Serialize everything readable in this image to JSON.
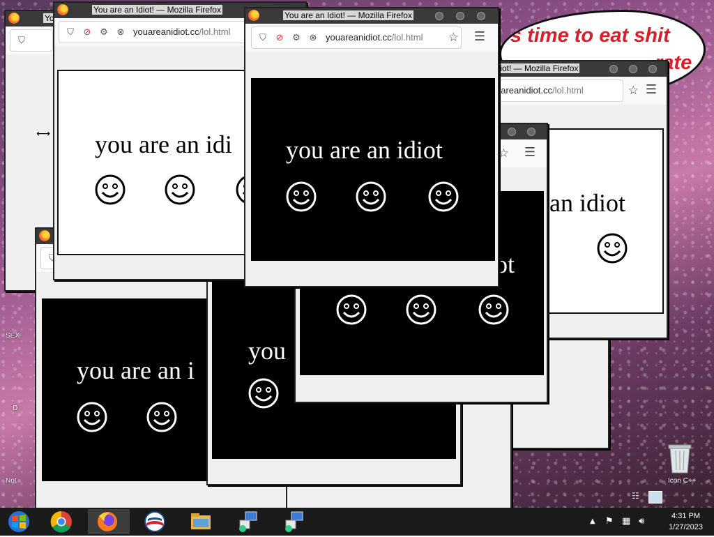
{
  "browser": {
    "title": "You are an Idiot! — Mozilla Firefox",
    "title_short": "Yo",
    "title_partial": "idiot! — Mozilla Firefox",
    "url_host": "youareanidiot.cc",
    "url_path": "/lol.html",
    "url_host_partial": "uareanidiot.cc"
  },
  "page": {
    "text": "you are an idiot",
    "text_cut1": "you are an idi",
    "text_cut2": "you are an i",
    "text_cut3": "you",
    "text_cut4": "an idiot",
    "text_cut5": "ot"
  },
  "desktop": {
    "speech_line1": "'s time to eat shit",
    "speech_line2": "rate",
    "label_sex": "SEX",
    "label_d": "D",
    "label_not": "Not",
    "label_icon": "Icon C++"
  },
  "taskbar": {
    "time": "4:31 PM",
    "date": "1/27/2023"
  }
}
